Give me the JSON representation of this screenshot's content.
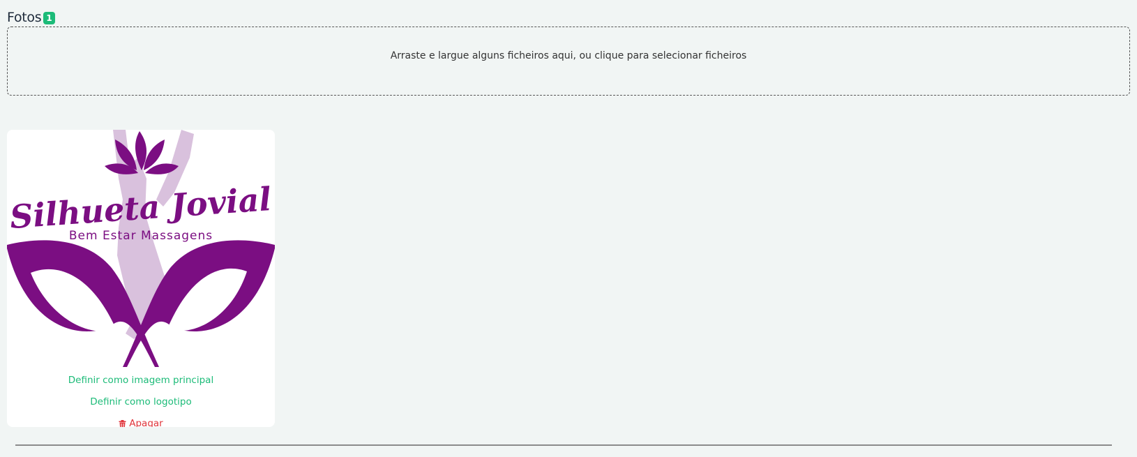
{
  "photos_section": {
    "title": "Fotos",
    "count": "1"
  },
  "dropzone": {
    "text": "Arraste e largue alguns ficheiros aqui, ou clique para selecionar ficheiros"
  },
  "photo": {
    "logo_name": "Silhueta Jovial",
    "logo_tagline": "Bem Estar Massagens",
    "actions": {
      "set_main": "Definir como imagem principal",
      "set_logo": "Definir como logotipo",
      "delete": "Apagar"
    }
  },
  "colors": {
    "accent": "#1cbb78",
    "danger": "#e0353b",
    "logo_purple": "#7b0e82",
    "logo_lilac": "#d9c1dd"
  }
}
